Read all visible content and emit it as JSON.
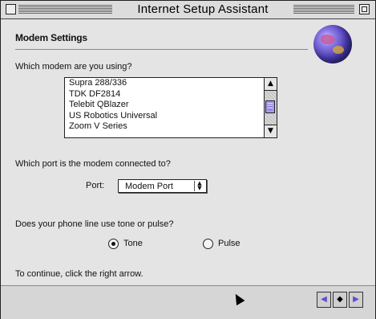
{
  "window": {
    "title": "Internet Setup Assistant"
  },
  "section": {
    "title": "Modem Settings"
  },
  "modem": {
    "question": "Which modem are you using?",
    "options": [
      "Supra 288/336",
      "TDK DF2814",
      "Telebit QBlazer",
      "US Robotics Universal",
      "Zoom V Series"
    ],
    "scroll_up_icon": "up-arrow-icon",
    "scroll_down_icon": "down-arrow-icon"
  },
  "port": {
    "question": "Which port is the modem connected to?",
    "label": "Port:",
    "selected": "Modem Port"
  },
  "dialing": {
    "question": "Does your phone line use tone or pulse?",
    "options": [
      {
        "label": "Tone",
        "selected": true
      },
      {
        "label": "Pulse",
        "selected": false
      }
    ]
  },
  "instructions": "To continue, click the right arrow.",
  "navigation": {
    "back_icon": "left-arrow-icon",
    "home_icon": "home-icon",
    "next_icon": "right-arrow-icon"
  },
  "colors": {
    "accent": "#5b4fd0",
    "window_background": "#e4e4e4"
  }
}
